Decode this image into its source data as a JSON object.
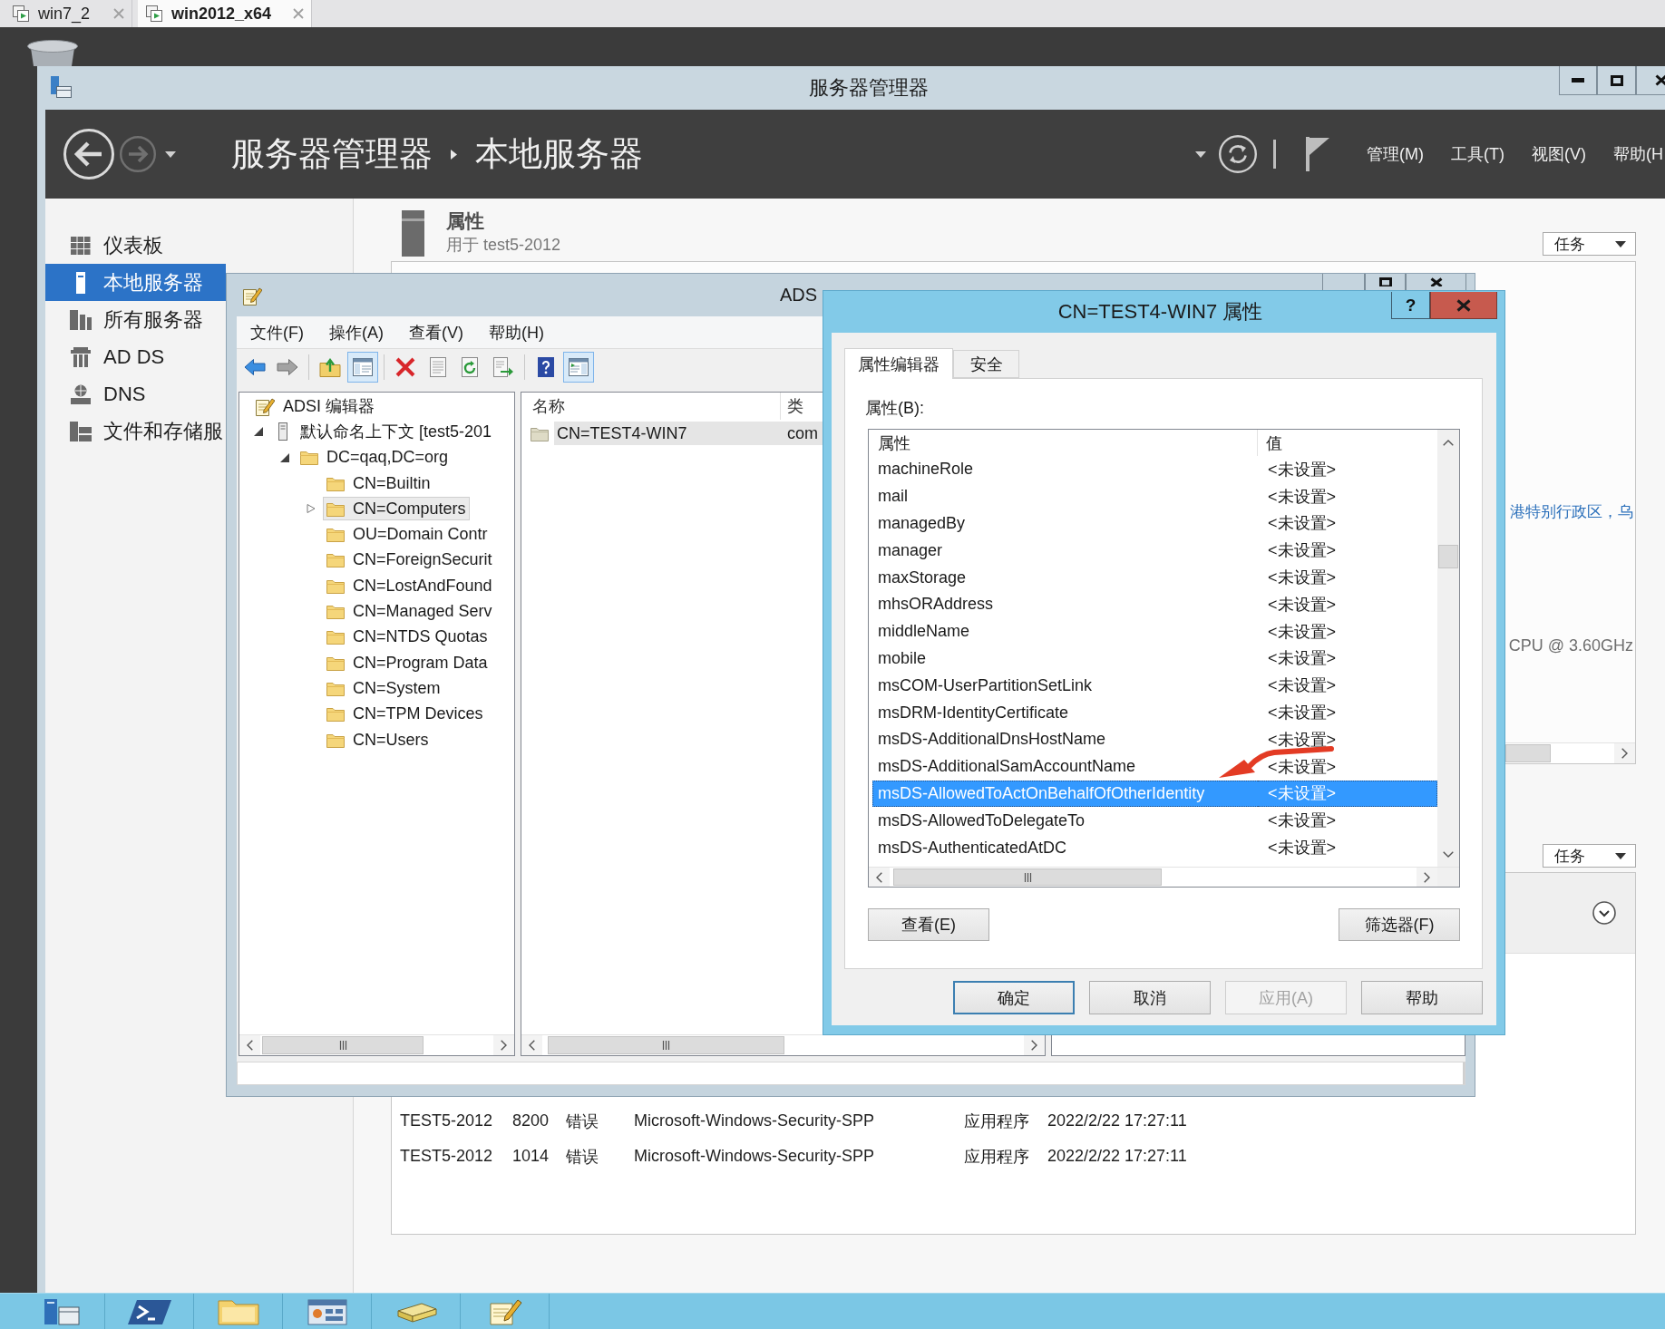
{
  "vm_tabs": [
    {
      "label": "win7_2",
      "selected": false
    },
    {
      "label": "win2012_x64",
      "selected": true
    }
  ],
  "server_manager": {
    "title": "服务器管理器",
    "breadcrumb": [
      "服务器管理器",
      "本地服务器"
    ],
    "menu": [
      "管理(M)",
      "工具(T)",
      "视图(V)",
      "帮助(H"
    ],
    "sidebar": [
      {
        "label": "仪表板",
        "selected": false
      },
      {
        "label": "本地服务器",
        "selected": true
      },
      {
        "label": "所有服务器",
        "selected": false
      },
      {
        "label": "AD DS",
        "selected": false
      },
      {
        "label": "DNS",
        "selected": false
      },
      {
        "label": "文件和存储服",
        "selected": false
      }
    ],
    "properties": {
      "title": "属性",
      "subtitle": "用于 test5-2012",
      "tasks": "任务",
      "time_zone": "港特别行政区，乌",
      "processor": "CPU @ 3.60GHz"
    },
    "events": {
      "tasks": "任务",
      "rows": [
        [
          "TEST5-2012",
          "8200",
          "错误",
          "Microsoft-Windows-Security-SPP",
          "应用程序",
          "2022/2/22 17:27:11"
        ],
        [
          "TEST5-2012",
          "1014",
          "错误",
          "Microsoft-Windows-Security-SPP",
          "应用程序",
          "2022/2/22 17:27:11"
        ]
      ]
    }
  },
  "adsi_editor": {
    "title": "ADS",
    "menu": [
      "文件(F)",
      "操作(A)",
      "查看(V)",
      "帮助(H)"
    ],
    "toolbar": [
      {
        "pressed": false
      },
      {
        "pressed": false
      },
      {
        "pressed": false
      },
      {
        "pressed": true
      },
      {
        "pressed": false
      },
      {
        "pressed": false
      },
      {
        "pressed": false
      },
      {
        "pressed": false
      },
      {
        "pressed": false
      },
      {
        "pressed": true
      }
    ],
    "tree": [
      {
        "label": "ADSI 编辑器",
        "selected": false,
        "children": [
          {
            "label": "默认命名上下文 [test5-201",
            "selected": false,
            "expanded": true,
            "children": [
              {
                "label": "DC=qaq,DC=org",
                "selected": false,
                "expanded": true,
                "children": [
                  {
                    "label": "CN=Builtin",
                    "selected": false
                  },
                  {
                    "label": "CN=Computers",
                    "selected": true,
                    "expanded": false
                  },
                  {
                    "label": "OU=Domain Contr",
                    "selected": false
                  },
                  {
                    "label": "CN=ForeignSecurit",
                    "selected": false
                  },
                  {
                    "label": "CN=LostAndFound",
                    "selected": false
                  },
                  {
                    "label": "CN=Managed Serv",
                    "selected": false
                  },
                  {
                    "label": "CN=NTDS Quotas",
                    "selected": false
                  },
                  {
                    "label": "CN=Program Data",
                    "selected": false
                  },
                  {
                    "label": "CN=System",
                    "selected": false
                  },
                  {
                    "label": "CN=TPM Devices",
                    "selected": false
                  },
                  {
                    "label": "CN=Users",
                    "selected": false
                  }
                ]
              }
            ]
          }
        ]
      }
    ],
    "list": {
      "columns": [
        "名称",
        "类"
      ],
      "rows": [
        {
          "name": "CN=TEST4-WIN7",
          "class": "com",
          "selected": true
        }
      ]
    }
  },
  "properties_dialog": {
    "title": "CN=TEST4-WIN7 属性",
    "help": "?",
    "tabs": [
      {
        "label": "属性编辑器",
        "selected": true
      },
      {
        "label": "安全",
        "selected": false
      }
    ],
    "attributes_label": "属性(B):",
    "columns": [
      "属性",
      "值"
    ],
    "rows": [
      {
        "name": "machineRole",
        "value": "<未设置>",
        "selected": false
      },
      {
        "name": "mail",
        "value": "<未设置>",
        "selected": false
      },
      {
        "name": "managedBy",
        "value": "<未设置>",
        "selected": false
      },
      {
        "name": "manager",
        "value": "<未设置>",
        "selected": false
      },
      {
        "name": "maxStorage",
        "value": "<未设置>",
        "selected": false
      },
      {
        "name": "mhsORAddress",
        "value": "<未设置>",
        "selected": false
      },
      {
        "name": "middleName",
        "value": "<未设置>",
        "selected": false
      },
      {
        "name": "mobile",
        "value": "<未设置>",
        "selected": false
      },
      {
        "name": "msCOM-UserPartitionSetLink",
        "value": "<未设置>",
        "selected": false
      },
      {
        "name": "msDRM-IdentityCertificate",
        "value": "<未设置>",
        "selected": false
      },
      {
        "name": "msDS-AdditionalDnsHostName",
        "value": "<未设置>",
        "selected": false
      },
      {
        "name": "msDS-AdditionalSamAccountName",
        "value": "<未设置>",
        "selected": false
      },
      {
        "name": "msDS-AllowedToActOnBehalfOfOtherIdentity",
        "value": "<未设置>",
        "selected": true
      },
      {
        "name": "msDS-AllowedToDelegateTo",
        "value": "<未设置>",
        "selected": false
      },
      {
        "name": "msDS-AuthenticatedAtDC",
        "value": "<未设置>",
        "selected": false
      }
    ],
    "view_button": "查看(E)",
    "filter_button": "筛选器(F)",
    "buttons": [
      {
        "label": "确定",
        "default": true,
        "disabled": false
      },
      {
        "label": "取消",
        "default": false,
        "disabled": false
      },
      {
        "label": "应用(A)",
        "default": false,
        "disabled": true
      },
      {
        "label": "帮助",
        "default": false,
        "disabled": false
      }
    ]
  }
}
